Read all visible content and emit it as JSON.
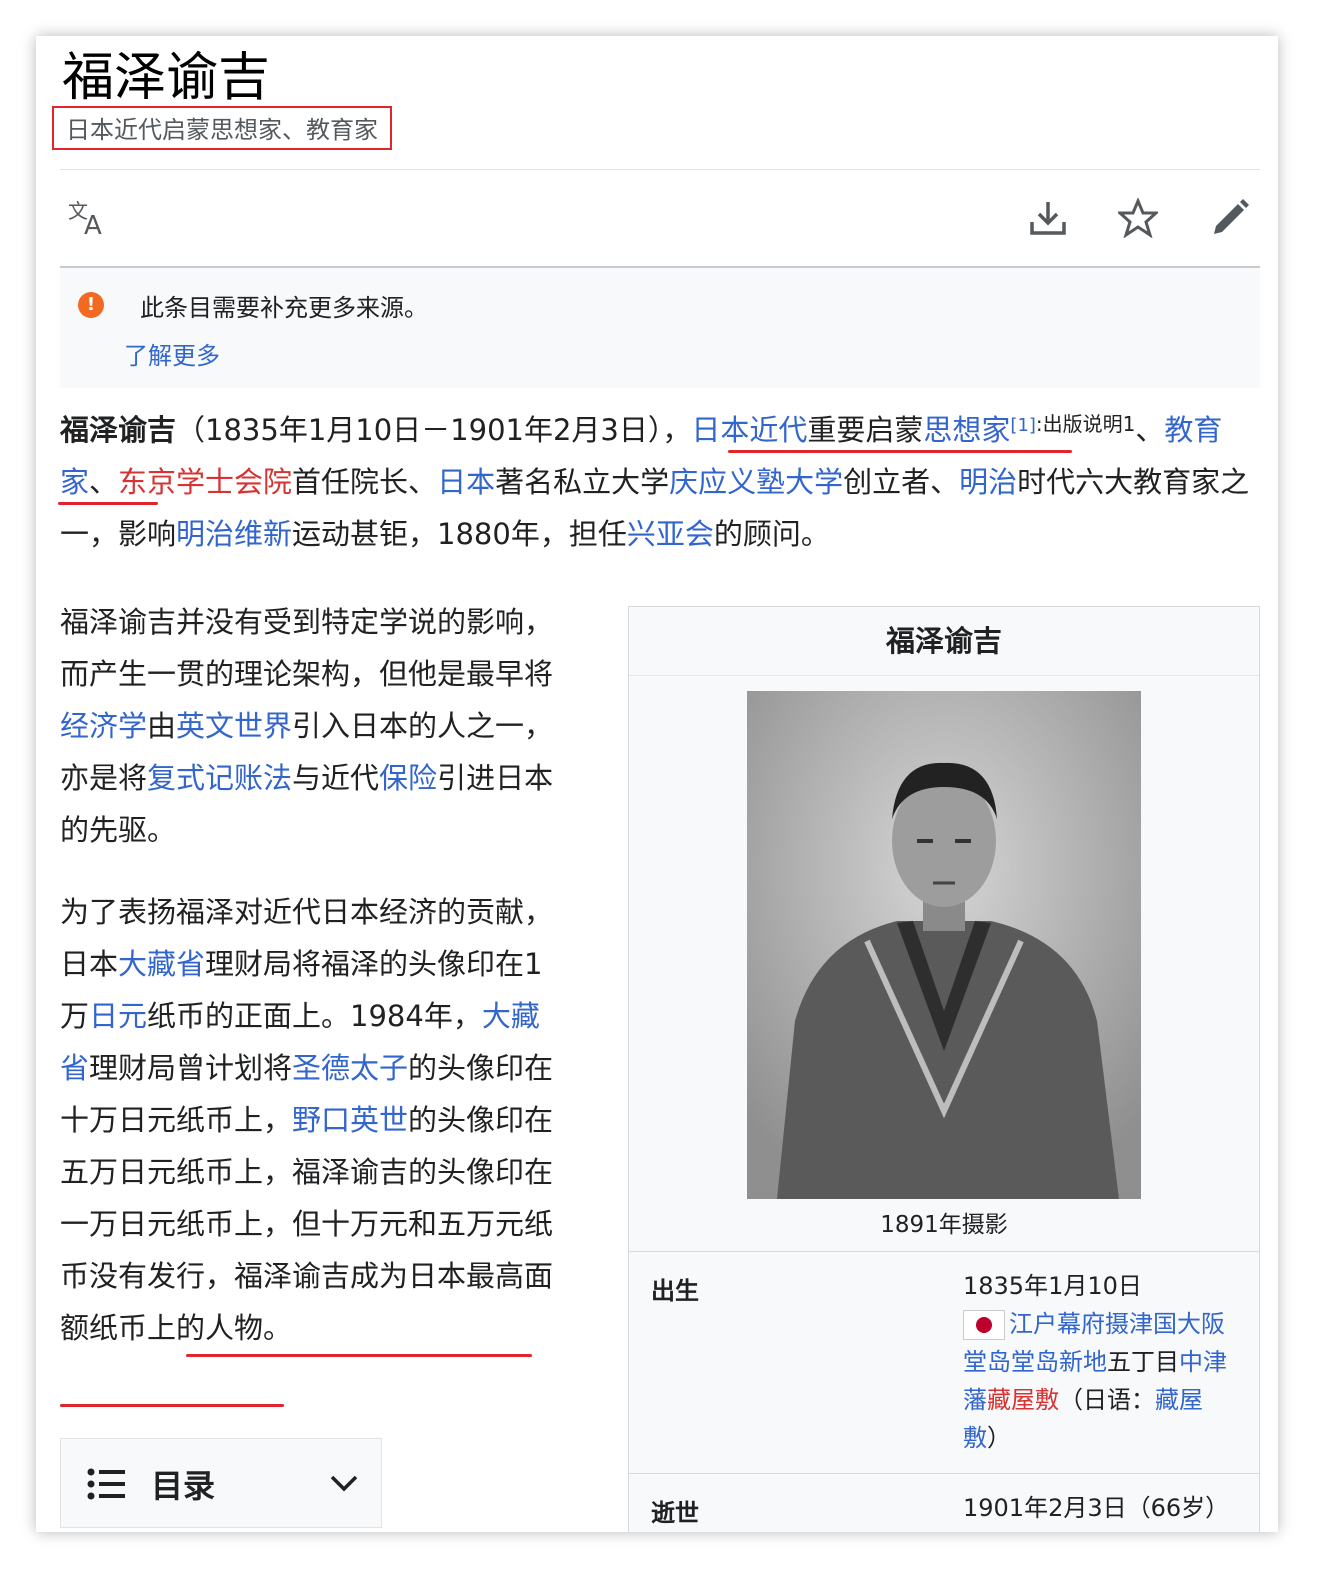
{
  "page": {
    "title": "福泽谕吉",
    "subtitle": "日本近代启蒙思想家、教育家"
  },
  "toolbar": {
    "icons": [
      "translate-icon",
      "download-icon",
      "star-icon",
      "edit-icon"
    ]
  },
  "notice": {
    "icon": "warning-icon",
    "message": "此条目需要补充更多来源。",
    "link": "了解更多"
  },
  "lead": {
    "name": "福泽谕吉",
    "dates": "（1835年1月10日－1901年2月3日），",
    "l_japan_modern": "日本近代",
    "t_important": "重要启蒙",
    "l_thinker": "思想家",
    "ref1": "[1]",
    "note1": ":出版说明1",
    "sep1": "、",
    "l_educator": "教育家",
    "sep2": "、",
    "l_tokyo_academy": "东京学士会院",
    "t_first_president": "首任院长、",
    "l_japan": "日本",
    "t_famous": "著名私立大学",
    "l_keio": "庆应义塾大学",
    "t_founder": "创立者、",
    "l_meiji": "明治",
    "t_era": "时代六大教育家之一，影响",
    "l_restoration": "明治维新",
    "t_movement": "运动甚钜，1880年，担任",
    "l_koa": "兴亚会",
    "t_advisor": "的顾问。"
  },
  "para1": {
    "t1": "福泽谕吉并没有受到特定学说的影响，而产生一贯的理论架构，但他是最早将",
    "l_economics": "经济学",
    "t2": "由",
    "l_english": "英文世界",
    "t3": "引入日本的人之一，亦是将",
    "l_double_entry": "复式记账法",
    "t4": "与近代",
    "l_insurance": "保险",
    "t5": "引进日本的先驱。"
  },
  "para2": {
    "t1": "为了表扬福泽对近代日本经济的贡献，日本",
    "l_mof1": "大藏省",
    "t2": "理财局将福泽的头像印在1万",
    "l_yen": "日元",
    "t3": "纸币的正面上。1984年，",
    "l_mof2": "大藏省",
    "t4": "理财局曾计划将",
    "l_shotoku": "圣德太子",
    "t5": "的头像印在十万日元纸币上，",
    "l_noguchi": "野口英世",
    "t6": "的头像印在五万日元纸币上，福泽谕吉的头像印在一万日元纸币上，但十万元和五万元纸币没有发行，",
    "t7": "福泽谕吉成为日本最高面额纸币上的人物",
    "t8": "。"
  },
  "toc": {
    "icon": "list-icon",
    "label": "目录",
    "chevron": "chevron-down-icon"
  },
  "infobox": {
    "title": "福泽谕吉",
    "caption": "1891年摄影",
    "born_label": "出生",
    "born_date": "1835年1月10日",
    "born_place_l1": "江户幕府摄津国大阪堂岛堂岛新地",
    "born_place_t1": "五丁目",
    "born_place_l2": "中津藩",
    "born_place_l3": "藏屋敷",
    "born_place_t2": "（日语：",
    "born_place_l4": "藏屋敷",
    "born_place_t3": "）",
    "died_label": "逝世",
    "died_date": "1901年2月3日（66岁）"
  }
}
